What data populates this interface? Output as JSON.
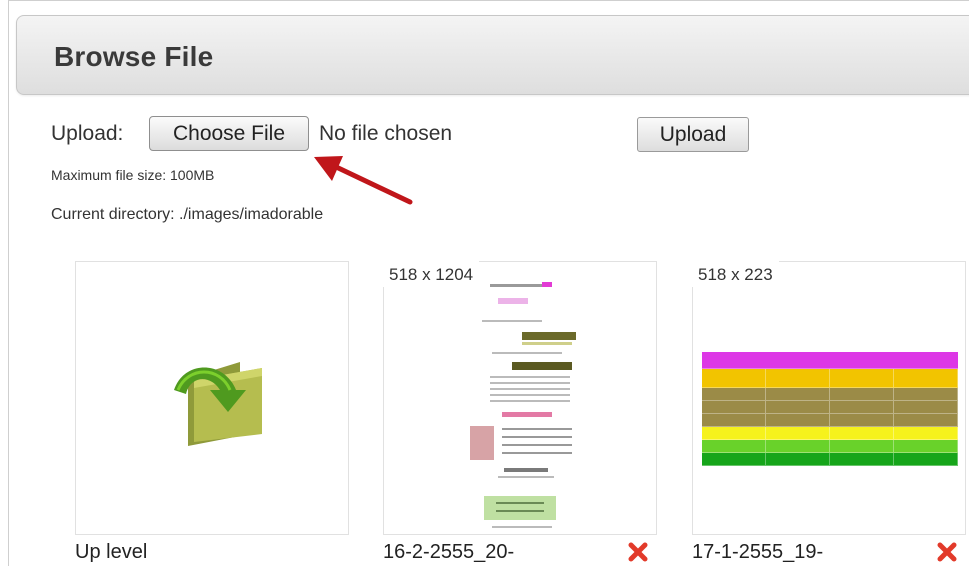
{
  "page": {
    "title": "Browse File"
  },
  "upload": {
    "label": "Upload:",
    "choose_button": "Choose File",
    "file_status": "No file chosen",
    "upload_button": "Upload",
    "max_size": "Maximum file size: 100MB",
    "current_directory": "Current directory: ./images/imadorable"
  },
  "tiles": [
    {
      "caption": "Up level",
      "dims": ""
    },
    {
      "caption": "16-2-2555_20-",
      "dims": "518 x 1204"
    },
    {
      "caption": "17-1-2555_19-",
      "dims": "518 x 223"
    }
  ],
  "colors": {
    "arrow": "#c0161a",
    "delete": "#e23a2a",
    "folder_green": "#5a9a1f",
    "table_title": "#dd37e6",
    "table_header": "#f2c400",
    "table_olive": "#9b8b47",
    "table_yellow": "#f6f21c",
    "table_green": "#2bb515"
  }
}
